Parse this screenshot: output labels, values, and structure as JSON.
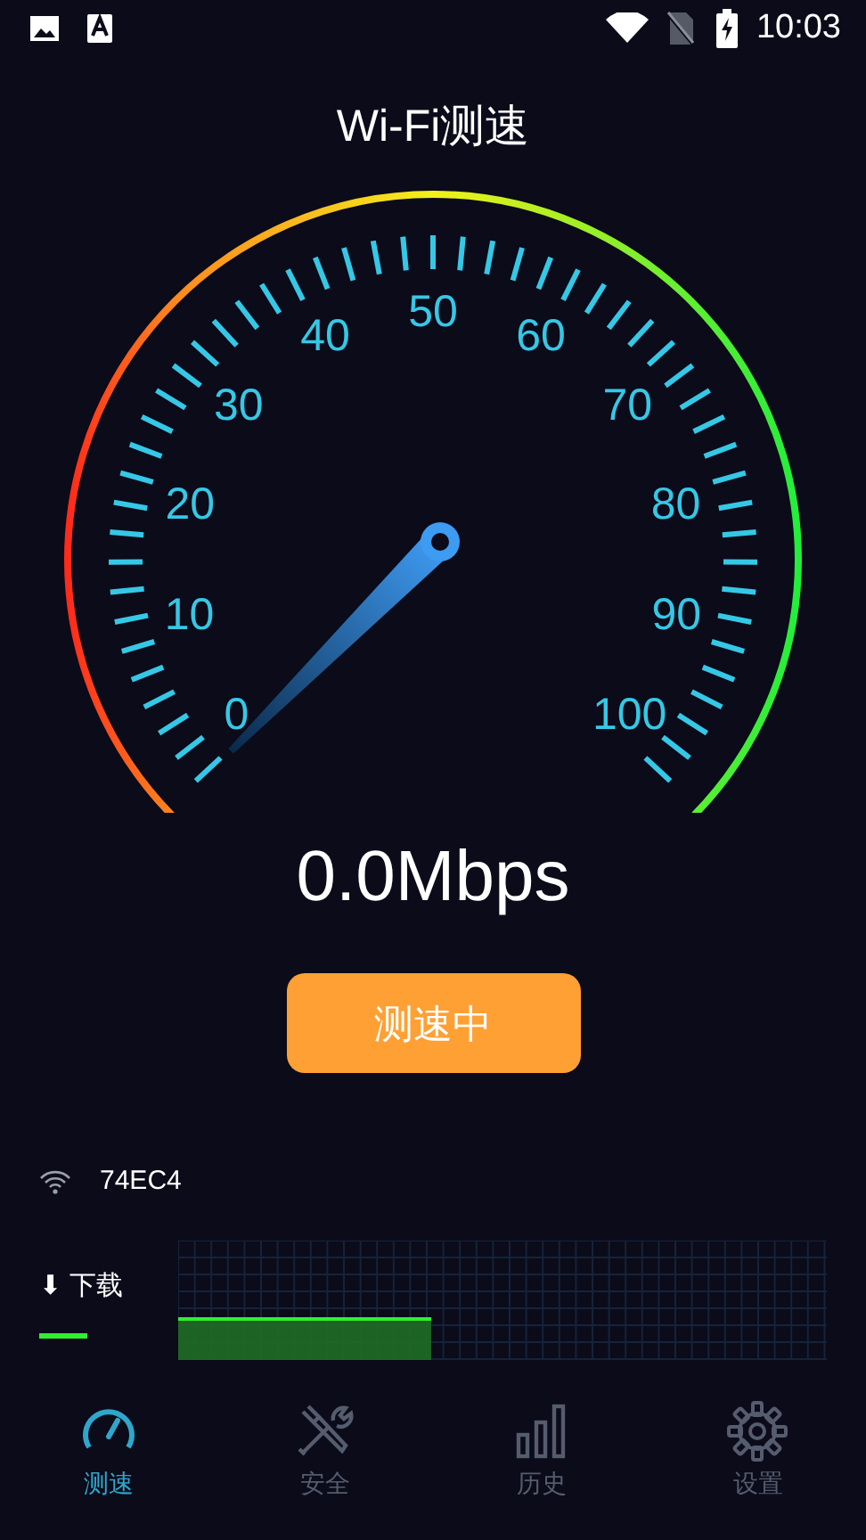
{
  "status_bar": {
    "time": "10:03"
  },
  "title": "Wi-Fi测速",
  "gauge": {
    "scale_labels": [
      "0",
      "10",
      "20",
      "30",
      "40",
      "50",
      "60",
      "70",
      "80",
      "90",
      "100"
    ]
  },
  "reading": "0.0Mbps",
  "action_button": "测速中",
  "network": {
    "name": "74EC4"
  },
  "legend": {
    "label": "下载",
    "arrow": "⬇"
  },
  "tabs": [
    {
      "label": "测速",
      "kind": "speed",
      "selected": true
    },
    {
      "label": "安全",
      "kind": "tools",
      "selected": false
    },
    {
      "label": "历史",
      "kind": "history",
      "selected": false
    },
    {
      "label": "设置",
      "kind": "settings",
      "selected": false
    }
  ]
}
